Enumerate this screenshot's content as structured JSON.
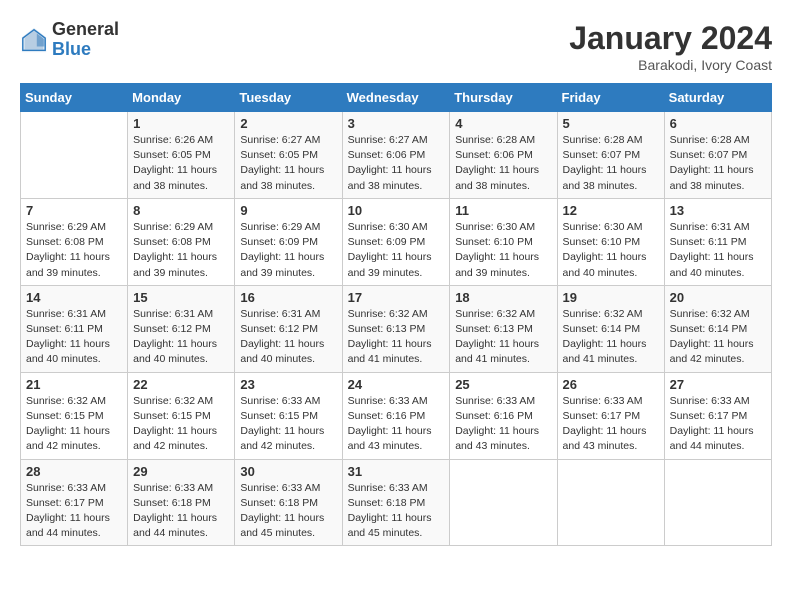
{
  "header": {
    "logo_general": "General",
    "logo_blue": "Blue",
    "month_title": "January 2024",
    "subtitle": "Barakodi, Ivory Coast"
  },
  "days_of_week": [
    "Sunday",
    "Monday",
    "Tuesday",
    "Wednesday",
    "Thursday",
    "Friday",
    "Saturday"
  ],
  "weeks": [
    [
      {
        "day": "",
        "info": ""
      },
      {
        "day": "1",
        "info": "Sunrise: 6:26 AM\nSunset: 6:05 PM\nDaylight: 11 hours and 38 minutes."
      },
      {
        "day": "2",
        "info": "Sunrise: 6:27 AM\nSunset: 6:05 PM\nDaylight: 11 hours and 38 minutes."
      },
      {
        "day": "3",
        "info": "Sunrise: 6:27 AM\nSunset: 6:06 PM\nDaylight: 11 hours and 38 minutes."
      },
      {
        "day": "4",
        "info": "Sunrise: 6:28 AM\nSunset: 6:06 PM\nDaylight: 11 hours and 38 minutes."
      },
      {
        "day": "5",
        "info": "Sunrise: 6:28 AM\nSunset: 6:07 PM\nDaylight: 11 hours and 38 minutes."
      },
      {
        "day": "6",
        "info": "Sunrise: 6:28 AM\nSunset: 6:07 PM\nDaylight: 11 hours and 38 minutes."
      }
    ],
    [
      {
        "day": "7",
        "info": "Sunrise: 6:29 AM\nSunset: 6:08 PM\nDaylight: 11 hours and 39 minutes."
      },
      {
        "day": "8",
        "info": "Sunrise: 6:29 AM\nSunset: 6:08 PM\nDaylight: 11 hours and 39 minutes."
      },
      {
        "day": "9",
        "info": "Sunrise: 6:29 AM\nSunset: 6:09 PM\nDaylight: 11 hours and 39 minutes."
      },
      {
        "day": "10",
        "info": "Sunrise: 6:30 AM\nSunset: 6:09 PM\nDaylight: 11 hours and 39 minutes."
      },
      {
        "day": "11",
        "info": "Sunrise: 6:30 AM\nSunset: 6:10 PM\nDaylight: 11 hours and 39 minutes."
      },
      {
        "day": "12",
        "info": "Sunrise: 6:30 AM\nSunset: 6:10 PM\nDaylight: 11 hours and 40 minutes."
      },
      {
        "day": "13",
        "info": "Sunrise: 6:31 AM\nSunset: 6:11 PM\nDaylight: 11 hours and 40 minutes."
      }
    ],
    [
      {
        "day": "14",
        "info": "Sunrise: 6:31 AM\nSunset: 6:11 PM\nDaylight: 11 hours and 40 minutes."
      },
      {
        "day": "15",
        "info": "Sunrise: 6:31 AM\nSunset: 6:12 PM\nDaylight: 11 hours and 40 minutes."
      },
      {
        "day": "16",
        "info": "Sunrise: 6:31 AM\nSunset: 6:12 PM\nDaylight: 11 hours and 40 minutes."
      },
      {
        "day": "17",
        "info": "Sunrise: 6:32 AM\nSunset: 6:13 PM\nDaylight: 11 hours and 41 minutes."
      },
      {
        "day": "18",
        "info": "Sunrise: 6:32 AM\nSunset: 6:13 PM\nDaylight: 11 hours and 41 minutes."
      },
      {
        "day": "19",
        "info": "Sunrise: 6:32 AM\nSunset: 6:14 PM\nDaylight: 11 hours and 41 minutes."
      },
      {
        "day": "20",
        "info": "Sunrise: 6:32 AM\nSunset: 6:14 PM\nDaylight: 11 hours and 42 minutes."
      }
    ],
    [
      {
        "day": "21",
        "info": "Sunrise: 6:32 AM\nSunset: 6:15 PM\nDaylight: 11 hours and 42 minutes."
      },
      {
        "day": "22",
        "info": "Sunrise: 6:32 AM\nSunset: 6:15 PM\nDaylight: 11 hours and 42 minutes."
      },
      {
        "day": "23",
        "info": "Sunrise: 6:33 AM\nSunset: 6:15 PM\nDaylight: 11 hours and 42 minutes."
      },
      {
        "day": "24",
        "info": "Sunrise: 6:33 AM\nSunset: 6:16 PM\nDaylight: 11 hours and 43 minutes."
      },
      {
        "day": "25",
        "info": "Sunrise: 6:33 AM\nSunset: 6:16 PM\nDaylight: 11 hours and 43 minutes."
      },
      {
        "day": "26",
        "info": "Sunrise: 6:33 AM\nSunset: 6:17 PM\nDaylight: 11 hours and 43 minutes."
      },
      {
        "day": "27",
        "info": "Sunrise: 6:33 AM\nSunset: 6:17 PM\nDaylight: 11 hours and 44 minutes."
      }
    ],
    [
      {
        "day": "28",
        "info": "Sunrise: 6:33 AM\nSunset: 6:17 PM\nDaylight: 11 hours and 44 minutes."
      },
      {
        "day": "29",
        "info": "Sunrise: 6:33 AM\nSunset: 6:18 PM\nDaylight: 11 hours and 44 minutes."
      },
      {
        "day": "30",
        "info": "Sunrise: 6:33 AM\nSunset: 6:18 PM\nDaylight: 11 hours and 45 minutes."
      },
      {
        "day": "31",
        "info": "Sunrise: 6:33 AM\nSunset: 6:18 PM\nDaylight: 11 hours and 45 minutes."
      },
      {
        "day": "",
        "info": ""
      },
      {
        "day": "",
        "info": ""
      },
      {
        "day": "",
        "info": ""
      }
    ]
  ]
}
